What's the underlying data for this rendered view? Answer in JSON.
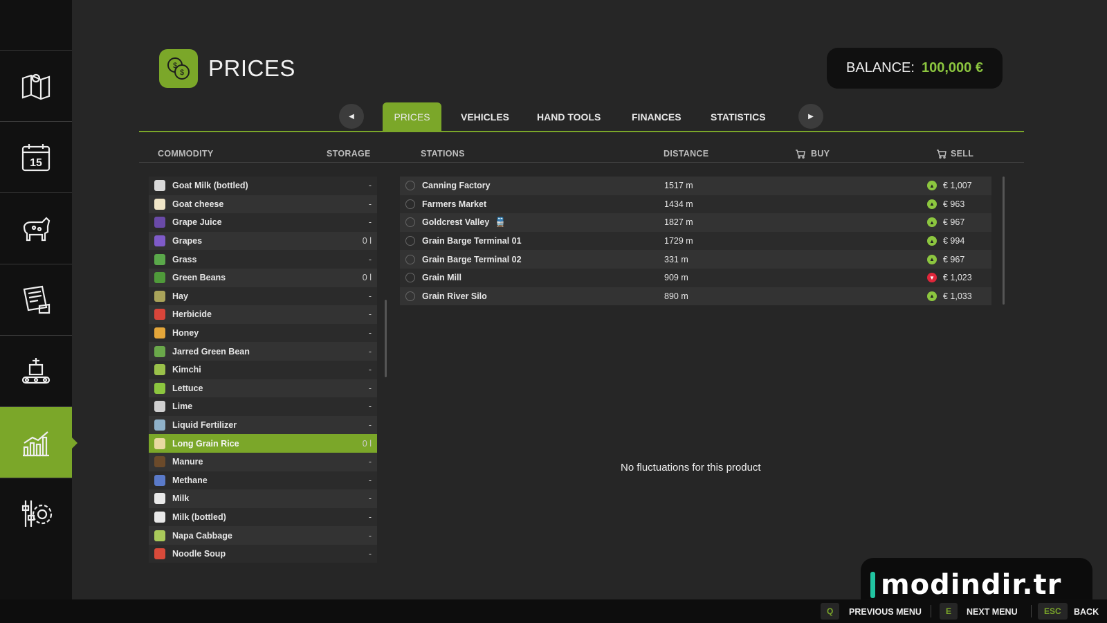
{
  "sidebar": {
    "items": [
      {
        "icon": "map-icon"
      },
      {
        "icon": "calendar-icon",
        "text": "15"
      },
      {
        "icon": "cow-icon"
      },
      {
        "icon": "contracts-icon"
      },
      {
        "icon": "production-icon"
      },
      {
        "icon": "prices-chart-icon"
      },
      {
        "icon": "settings-icon"
      }
    ]
  },
  "header": {
    "title": "PRICES",
    "balance_label": "BALANCE:",
    "balance_value": "100,000 €"
  },
  "tabs": [
    "PRICES",
    "VEHICLES",
    "HAND TOOLS",
    "FINANCES",
    "STATISTICS"
  ],
  "columns": {
    "commodity": "COMMODITY",
    "storage": "STORAGE",
    "stations": "STATIONS",
    "distance": "DISTANCE",
    "buy": "BUY",
    "sell": "SELL"
  },
  "commodities": [
    {
      "name": "Goat Milk (bottled)",
      "storage": "-",
      "color": "#d9d9d9"
    },
    {
      "name": "Goat cheese",
      "storage": "-",
      "color": "#f0e6c8"
    },
    {
      "name": "Grape Juice",
      "storage": "-",
      "color": "#6a4aa8"
    },
    {
      "name": "Grapes",
      "storage": "0 l",
      "color": "#7f5bc9"
    },
    {
      "name": "Grass",
      "storage": "-",
      "color": "#5aa84a"
    },
    {
      "name": "Green Beans",
      "storage": "0 l",
      "color": "#4f9a3a"
    },
    {
      "name": "Hay",
      "storage": "-",
      "color": "#a9a35a"
    },
    {
      "name": "Herbicide",
      "storage": "-",
      "color": "#d8453a"
    },
    {
      "name": "Honey",
      "storage": "-",
      "color": "#e4a63a"
    },
    {
      "name": "Jarred Green Bean",
      "storage": "-",
      "color": "#6aa84a"
    },
    {
      "name": "Kimchi",
      "storage": "-",
      "color": "#9ac14a"
    },
    {
      "name": "Lettuce",
      "storage": "-",
      "color": "#8cc63f"
    },
    {
      "name": "Lime",
      "storage": "-",
      "color": "#cfcfcf"
    },
    {
      "name": "Liquid Fertilizer",
      "storage": "-",
      "color": "#8fb1c9"
    },
    {
      "name": "Long Grain Rice",
      "storage": "0 l",
      "color": "#e8d9a0",
      "selected": true
    },
    {
      "name": "Manure",
      "storage": "-",
      "color": "#6b4a2a"
    },
    {
      "name": "Methane",
      "storage": "-",
      "color": "#5a7ac9"
    },
    {
      "name": "Milk",
      "storage": "-",
      "color": "#e8e8e8"
    },
    {
      "name": "Milk (bottled)",
      "storage": "-",
      "color": "#e8e8e8"
    },
    {
      "name": "Napa Cabbage",
      "storage": "-",
      "color": "#a9c95a"
    },
    {
      "name": "Noodle Soup",
      "storage": "-",
      "color": "#d84a3a"
    }
  ],
  "stations": [
    {
      "name": "Canning Factory",
      "distance": "1517 m",
      "trend": "up",
      "sell": "€ 1,007"
    },
    {
      "name": "Farmers Market",
      "distance": "1434 m",
      "trend": "up",
      "sell": "€ 963"
    },
    {
      "name": "Goldcrest Valley",
      "distance": "1827 m",
      "trend": "up",
      "sell": "€ 967",
      "train": true
    },
    {
      "name": "Grain Barge Terminal 01",
      "distance": "1729 m",
      "trend": "up",
      "sell": "€ 994"
    },
    {
      "name": "Grain Barge Terminal 02",
      "distance": "331 m",
      "trend": "up",
      "sell": "€ 967"
    },
    {
      "name": "Grain Mill",
      "distance": "909 m",
      "trend": "down",
      "sell": "€ 1,023"
    },
    {
      "name": "Grain River Silo",
      "distance": "890 m",
      "trend": "up",
      "sell": "€ 1,033"
    }
  ],
  "empty_message": "No fluctuations for this product",
  "watermark": "modindir.tr",
  "bottom_bar": [
    {
      "key": "Q",
      "label": "PREVIOUS MENU"
    },
    {
      "key": "E",
      "label": "NEXT MENU"
    },
    {
      "key": "ESC",
      "label": "BACK"
    }
  ],
  "colors": {
    "accent": "#7ba729",
    "balance_value": "#8cc63f",
    "trend_up": "#8cc63f",
    "trend_down": "#e0263a"
  }
}
